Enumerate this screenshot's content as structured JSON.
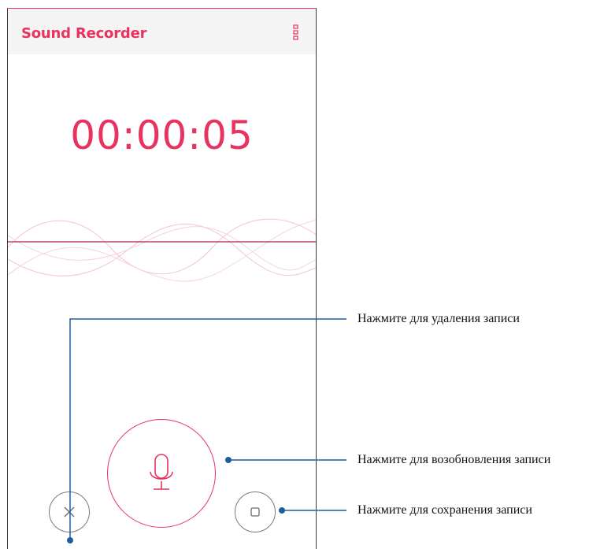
{
  "app": {
    "title": "Sound Recorder",
    "menu_icon": "more-vert-icon"
  },
  "recording": {
    "elapsed_time": "00:00:05"
  },
  "controls": {
    "delete_icon": "close-icon",
    "record_icon": "microphone-icon",
    "stop_icon": "stop-square-icon"
  },
  "callouts": {
    "delete": "Нажмите для удаления записи",
    "resume": "Нажмите для возобновления записи",
    "save": "Нажмите для сохранения записи"
  },
  "colors": {
    "accent": "#e8335f",
    "callout_line": "#1f5e9e"
  }
}
